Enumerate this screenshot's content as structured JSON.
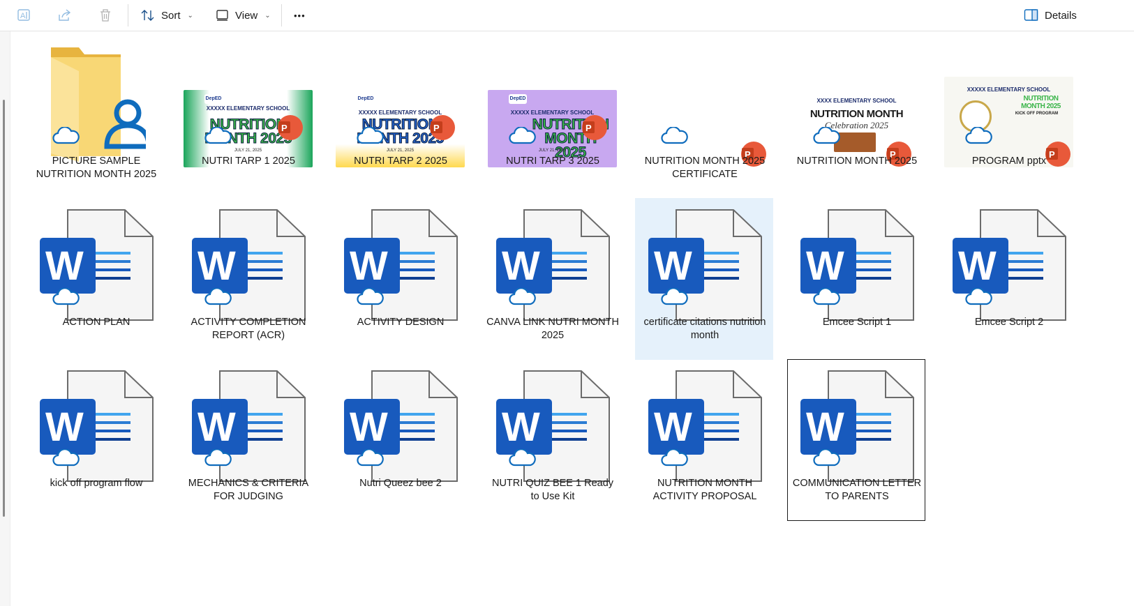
{
  "toolbar": {
    "sort_label": "Sort",
    "view_label": "View",
    "more_label": "•••",
    "details_label": "Details"
  },
  "colors": {
    "word_blue": "#185abd",
    "word_blue_dark": "#103f91",
    "ppt_red": "#c43e1c",
    "cloud_blue": "#0f6cbd",
    "folder_yellow": "#f8d775",
    "selection_bg": "#e5f1fb"
  },
  "files": [
    {
      "name": "PICTURE SAMPLE NUTRITION MONTH 2025",
      "type": "folder"
    },
    {
      "name": "NUTRI TARP 1 2025",
      "type": "pptx-image"
    },
    {
      "name": "NUTRI TARP 2 2025",
      "type": "pptx-image"
    },
    {
      "name": "NUTRI TARP 3 2025",
      "type": "pptx-image"
    },
    {
      "name": "NUTRITION MONTH 2025 CERTIFICATE",
      "type": "pptx"
    },
    {
      "name": "NUTRITION MONTH 2025",
      "type": "pptx-image"
    },
    {
      "name": "PROGRAM pptx",
      "type": "pptx-image"
    },
    {
      "name": "ACTION PLAN",
      "type": "docx"
    },
    {
      "name": "ACTIVITY COMPLETION REPORT (ACR)",
      "type": "docx"
    },
    {
      "name": "ACTIVITY DESIGN",
      "type": "docx"
    },
    {
      "name": "CANVA LINK NUTRI MONTH 2025",
      "type": "docx"
    },
    {
      "name": "certificate citations nutrition month",
      "type": "docx",
      "selected": true
    },
    {
      "name": "Emcee Script 1",
      "type": "docx"
    },
    {
      "name": "Emcee Script 2",
      "type": "docx"
    },
    {
      "name": "kick off program flow",
      "type": "docx"
    },
    {
      "name": "MECHANICS & CRITERIA FOR JUDGING",
      "type": "docx"
    },
    {
      "name": "Nutri Queez bee 2",
      "type": "docx"
    },
    {
      "name": "NUTRI QUIZ BEE 1 Ready to Use Kit",
      "type": "docx"
    },
    {
      "name": "NUTRITION MONTH ACTIVITY PROPOSAL",
      "type": "docx"
    },
    {
      "name": "COMMUNICATION LETTER TO PARENTS",
      "type": "docx",
      "focused": true
    }
  ],
  "thumbnails": {
    "tarp1": {
      "logo": "DepED",
      "title": "NUTRITION MONTH 2025",
      "school": "XXXXX ELEMENTARY SCHOOL",
      "date": "JULY 21, 2025"
    },
    "tarp2": {
      "logo": "DepED",
      "title": "NUTRITION MONTH 2025",
      "school": "XXXXX ELEMENTARY SCHOOL",
      "date": "JULY 21, 2025"
    },
    "tarp3": {
      "logo": "DepED",
      "title": "NUTRITION MONTH 2025",
      "school": "XXXXX ELEMENTARY SCHOOL",
      "date": "JULY 21, 2025"
    },
    "nm": {
      "school": "XXXX ELEMENTARY SCHOOL",
      "title": "NUTRITION MONTH",
      "subtitle": "Celebration 2025"
    },
    "program": {
      "school": "XXXXX ELEMENTARY SCHOOL",
      "title": "NUTRITION MONTH 2025",
      "subtitle": "KICK OFF PROGRAM"
    }
  }
}
